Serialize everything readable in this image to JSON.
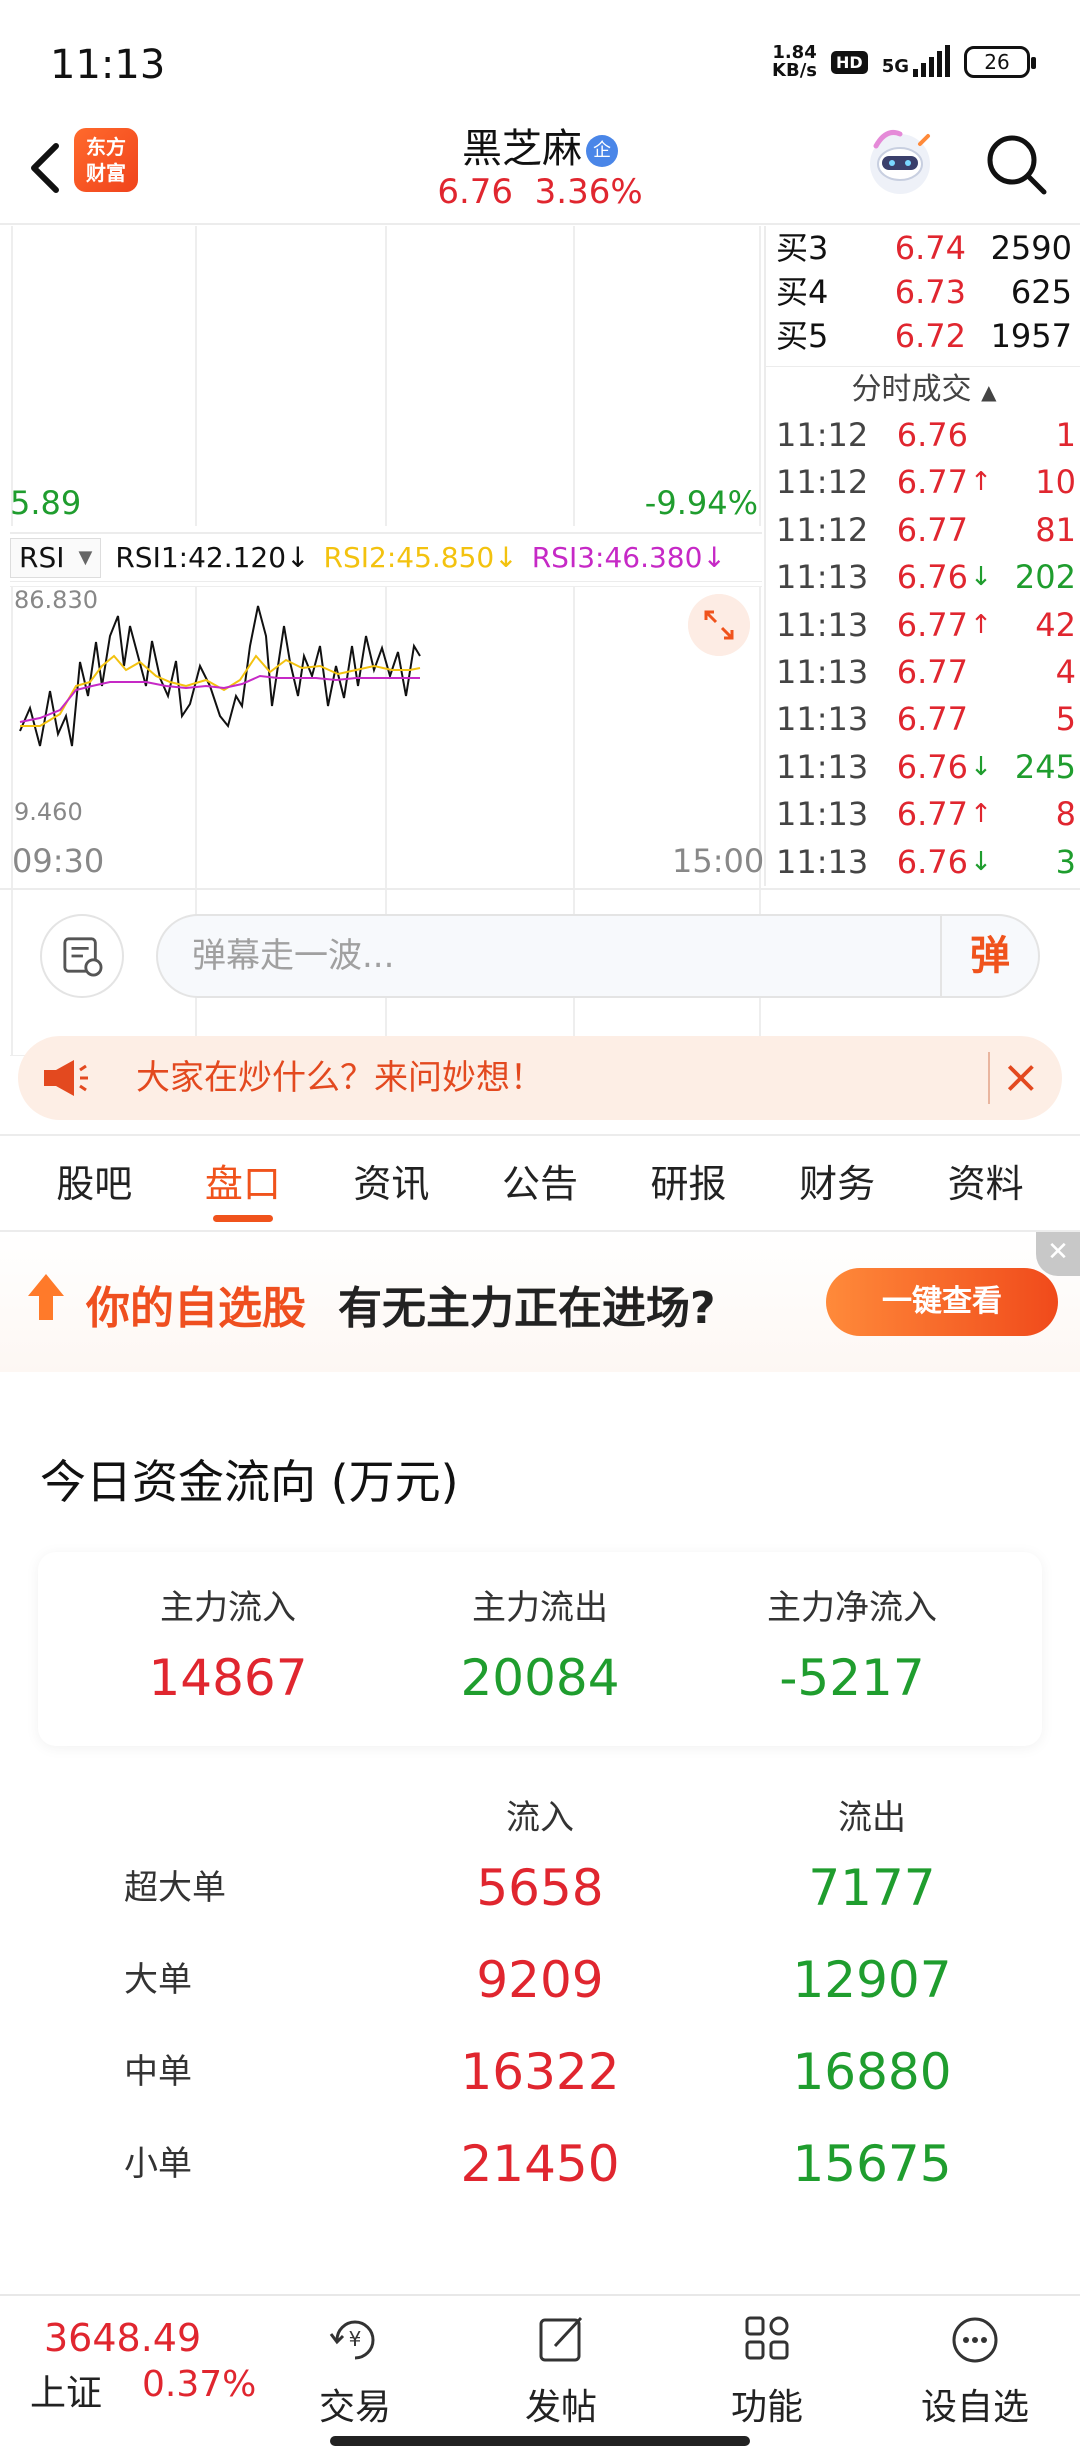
{
  "status_bar": {
    "time": "11:13",
    "net_speed_value": "1.84",
    "net_speed_unit": "KB/s",
    "hd": "HD",
    "network": "5G",
    "battery": "26"
  },
  "header": {
    "logo_line1": "东方",
    "logo_line2": "财富",
    "stock_name": "黑芝麻",
    "badge": "企",
    "price": "6.76",
    "change_pct": "3.36%"
  },
  "chart": {
    "price_low": "5.89",
    "pct_low": "-9.94%",
    "indicator": "RSI",
    "rsi1": "RSI1:42.120",
    "rsi2": "RSI2:45.850",
    "rsi3": "RSI3:46.380",
    "rsi_max": "86.830",
    "rsi_min": "9.460",
    "time_start": "09:30",
    "time_end": "15:00",
    "colors": {
      "rsi1": "#111111",
      "rsi2": "#f3c20f",
      "rsi3": "#c629c6"
    }
  },
  "order_book": {
    "bids": [
      {
        "label": "买3",
        "price": "6.74",
        "vol": "2590"
      },
      {
        "label": "买4",
        "price": "6.73",
        "vol": "625"
      },
      {
        "label": "买5",
        "price": "6.72",
        "vol": "1957"
      }
    ],
    "ticks_header": "分时成交",
    "ticks": [
      {
        "time": "11:12",
        "price": "6.76",
        "arrow": "",
        "vol": "1",
        "dir": "up"
      },
      {
        "time": "11:12",
        "price": "6.77",
        "arrow": "↑",
        "vol": "10",
        "dir": "up"
      },
      {
        "time": "11:12",
        "price": "6.77",
        "arrow": "",
        "vol": "81",
        "dir": "up"
      },
      {
        "time": "11:13",
        "price": "6.76",
        "arrow": "↓",
        "vol": "202",
        "dir": "down"
      },
      {
        "time": "11:13",
        "price": "6.77",
        "arrow": "↑",
        "vol": "42",
        "dir": "up"
      },
      {
        "time": "11:13",
        "price": "6.77",
        "arrow": "",
        "vol": "4",
        "dir": "up"
      },
      {
        "time": "11:13",
        "price": "6.77",
        "arrow": "",
        "vol": "5",
        "dir": "up"
      },
      {
        "time": "11:13",
        "price": "6.76",
        "arrow": "↓",
        "vol": "245",
        "dir": "down"
      },
      {
        "time": "11:13",
        "price": "6.77",
        "arrow": "↑",
        "vol": "8",
        "dir": "up"
      },
      {
        "time": "11:13",
        "price": "6.76",
        "arrow": "↓",
        "vol": "3",
        "dir": "down"
      }
    ]
  },
  "comment": {
    "placeholder": "弹幕走一波...",
    "send_label": "弹"
  },
  "ask_banner": {
    "text": "大家在炒什么？来问妙想！"
  },
  "tabs": [
    "股吧",
    "盘口",
    "资讯",
    "公告",
    "研报",
    "财务",
    "资料"
  ],
  "active_tab": 1,
  "promo": {
    "highlight": "你的自选股",
    "text": "有无主力正在进场?",
    "button": "一键查看"
  },
  "capital_flow": {
    "title": "今日资金流向 (万元)",
    "summary": [
      {
        "label": "主力流入",
        "value": "14867",
        "dir": "up"
      },
      {
        "label": "主力流出",
        "value": "20084",
        "dir": "down"
      },
      {
        "label": "主力净流入",
        "value": "-5217",
        "dir": "down"
      }
    ],
    "col_in": "流入",
    "col_out": "流出",
    "rows": [
      {
        "label": "超大单",
        "in": "5658",
        "out": "7177"
      },
      {
        "label": "大单",
        "in": "9209",
        "out": "12907"
      },
      {
        "label": "中单",
        "in": "16322",
        "out": "16880"
      },
      {
        "label": "小单",
        "in": "21450",
        "out": "15675"
      }
    ]
  },
  "bottom_nav": {
    "index_value": "3648.49",
    "index_name": "上证",
    "index_pct": "0.37%",
    "items": [
      {
        "label": "交易",
        "icon": "yen-trade-icon"
      },
      {
        "label": "发帖",
        "icon": "edit-post-icon"
      },
      {
        "label": "功能",
        "icon": "grid-function-icon"
      },
      {
        "label": "设自选",
        "icon": "more-dots-icon"
      }
    ]
  }
}
